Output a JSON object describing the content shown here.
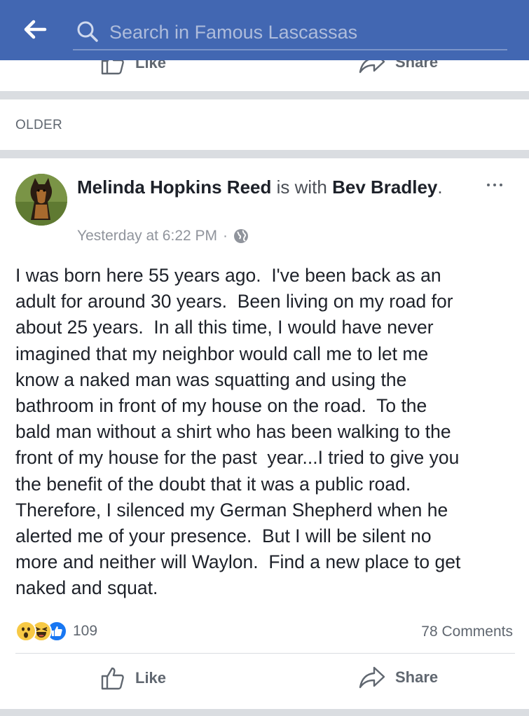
{
  "header": {
    "search_placeholder": "Search in Famous Lascassas",
    "bar_color": "#4267b2"
  },
  "previous_post": {
    "like_label": "Like",
    "share_label": "Share"
  },
  "section_label": "OLDER",
  "post": {
    "author": "Melinda Hopkins Reed",
    "with_text": " is with ",
    "tagged": "Bev Bradley",
    "punct": ".",
    "timestamp": "Yesterday at 6:22 PM",
    "dot": "·",
    "privacy_icon": "globe-icon",
    "body": "I was born here 55 years ago.  I've been back as an\nadult for around 30 years.  Been living on my road for\nabout 25 years.  In all this time, I would have never\nimagined that my neighbor would call me to let me\nknow a naked man was squatting and using the\nbathroom in front of my house on the road.  To the\nbald man without a shirt who has been walking to the\nfront of my house for the past  year...I tried to give you\nthe benefit of the doubt that it was a public road.\nTherefore, I silenced my German Shepherd when he\nalerted me of your presence.  But I will be silent no\nmore and neither will Waylon.  Find a new place to get\nnaked and squat.",
    "reactions": [
      "wow",
      "haha",
      "like"
    ],
    "reaction_count": "109",
    "comments": "78 Comments",
    "like_label": "Like",
    "share_label": "Share"
  }
}
